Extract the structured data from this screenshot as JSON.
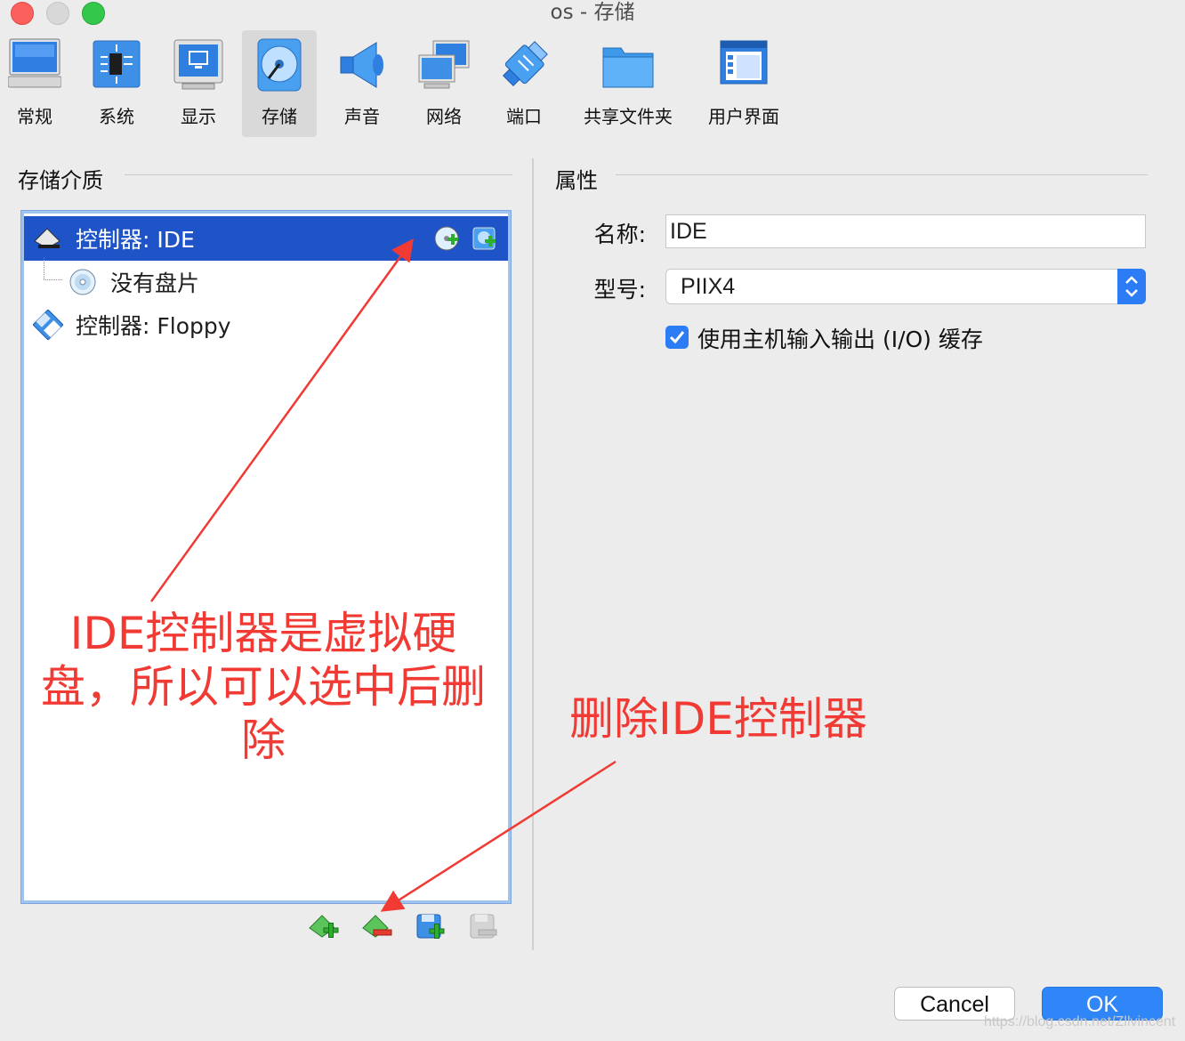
{
  "window": {
    "title": "os  - 存储",
    "controls": [
      "close",
      "minimize",
      "maximize"
    ]
  },
  "toolbar": {
    "items": [
      {
        "label": "常规",
        "icon": "monitor-general-icon"
      },
      {
        "label": "系统",
        "icon": "chip-system-icon"
      },
      {
        "label": "显示",
        "icon": "display-icon"
      },
      {
        "label": "存储",
        "icon": "disk-storage-icon",
        "active": true
      },
      {
        "label": "声音",
        "icon": "speaker-icon"
      },
      {
        "label": "网络",
        "icon": "network-icon"
      },
      {
        "label": "端口",
        "icon": "port-icon"
      },
      {
        "label": "共享文件夹",
        "icon": "folder-icon"
      },
      {
        "label": "用户界面",
        "icon": "user-interface-icon"
      }
    ]
  },
  "storage": {
    "title": "存储介质",
    "tree": [
      {
        "label": "控制器: IDE",
        "selected": true,
        "icon": "ide-controller-icon"
      },
      {
        "label": "没有盘片",
        "indent": true,
        "icon": "optical-disc-icon"
      },
      {
        "label": "控制器: Floppy",
        "icon": "floppy-controller-icon"
      }
    ],
    "bottom_buttons": [
      "add-controller-icon",
      "remove-controller-icon",
      "add-attachment-icon",
      "remove-attachment-icon"
    ]
  },
  "properties": {
    "title": "属性",
    "name_label": "名称:",
    "name_value": "IDE",
    "type_label": "型号:",
    "type_value": "PIIX4",
    "cache_label": "使用主机输入输出 (I/O) 缓存",
    "cache_checked": true
  },
  "annotations": {
    "note1": [
      "IDE控制器是虚拟硬",
      "盘，所以可以选中后删",
      "除"
    ],
    "note2": "删除IDE控制器",
    "color": "#f03a33"
  },
  "buttons": {
    "cancel": "Cancel",
    "ok": "OK"
  },
  "watermark": "https://blog.csdn.net/Zllvincent",
  "colors": {
    "accent": "#2c7cf6",
    "selection": "#1e54c8",
    "annotation": "#f03a33"
  }
}
